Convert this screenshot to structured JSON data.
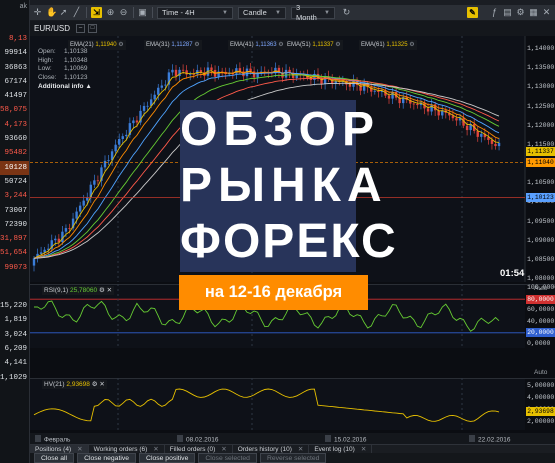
{
  "left_column": {
    "header": "ak",
    "quotes": [
      "8,13",
      "99914",
      "36863",
      "67174",
      "41497",
      "58,075",
      "4,173",
      "93660",
      "95482",
      "10128",
      "50724",
      "3,244",
      "73007",
      "72390",
      "31,897",
      "51,654",
      "99073"
    ],
    "highlight_index": 9,
    "lower_quotes": [
      "15,220",
      "1,819",
      "3,024",
      "6,209",
      "4,141",
      "1,1029"
    ]
  },
  "toolbar": {
    "timeframe": "Time - 4H",
    "chart_type": "Candle",
    "period": "3 Month"
  },
  "symbol": "EUR/USD",
  "ma_labels": [
    {
      "name": "EMA(21)",
      "value": "1,11940",
      "color": "#e7c000"
    },
    {
      "name": "EMA(31)",
      "value": "1,11287",
      "color": "#7fa8ff"
    },
    {
      "name": "EMA(41)",
      "value": "1,11363",
      "color": "#7fa8ff"
    },
    {
      "name": "EMA(51)",
      "value": "1,11337",
      "color": "#e7c000"
    },
    {
      "name": "EMA(61)",
      "value": "1,11325",
      "color": "#e7c000"
    }
  ],
  "ohlc": {
    "open_label": "Open:",
    "open": "1,10138",
    "high_label": "High:",
    "high": "1,10348",
    "low_label": "Low:",
    "low": "1,10069",
    "close_label": "Close:",
    "close": "1,10123",
    "more": "Additional info"
  },
  "price_axis": [
    "1,14000",
    "1,13500",
    "1,13000",
    "1,12500",
    "1,12000",
    "1,11500",
    "1,11000",
    "1,10500",
    "1,10000",
    "1,09500",
    "1,09000",
    "1,08500",
    "1,08000"
  ],
  "price_tags": [
    {
      "value": "1,11337",
      "color": "#e7c000"
    },
    {
      "value": "1,11040",
      "color": "#ff9900"
    },
    {
      "value": "1,10123",
      "color": "#5aa0ff"
    }
  ],
  "clock": "01:54",
  "banner": {
    "line1": "ОБЗОР",
    "line2": "РЫНКА",
    "line3": "ФОРЕКС",
    "date": "на 12-16 декабря"
  },
  "rsi": {
    "label": "RSI(9,1)",
    "value": "25,78060",
    "auto": "Auto",
    "levels": [
      "80,0000",
      "20,0000"
    ],
    "axis": [
      "100,0000",
      "80,0000",
      "60,0000",
      "40,0000",
      "20,0000",
      "0,0000"
    ]
  },
  "hv": {
    "label": "HV(21)",
    "value": "2,93698",
    "auto": "Auto",
    "axis": [
      "5,00000",
      "4,00000",
      "3,00000",
      "2,93698",
      "2,00000"
    ]
  },
  "date_axis": [
    "Февраль",
    "08.02.2016",
    "15.02.2016",
    "22.02.2016"
  ],
  "tabs": [
    {
      "label": "Positions (4)",
      "active": true
    },
    {
      "label": "Working orders (6)",
      "active": false
    },
    {
      "label": "Filled orders (0)",
      "active": false
    },
    {
      "label": "Orders history (10)",
      "active": false
    },
    {
      "label": "Event log (10)",
      "active": false
    }
  ],
  "actions": [
    {
      "label": "Close all",
      "enabled": true
    },
    {
      "label": "Close negative",
      "enabled": true
    },
    {
      "label": "Close positive",
      "enabled": true
    },
    {
      "label": "Close selected",
      "enabled": false
    },
    {
      "label": "Reverse selected",
      "enabled": false
    }
  ],
  "colors": {
    "bull": "#3b7dd8",
    "bear": "#e0443c",
    "banner_bg": "#28345a",
    "badge_bg": "#ff8c00",
    "rsi_line": "#66cc33",
    "hv_line": "#e7c000"
  }
}
